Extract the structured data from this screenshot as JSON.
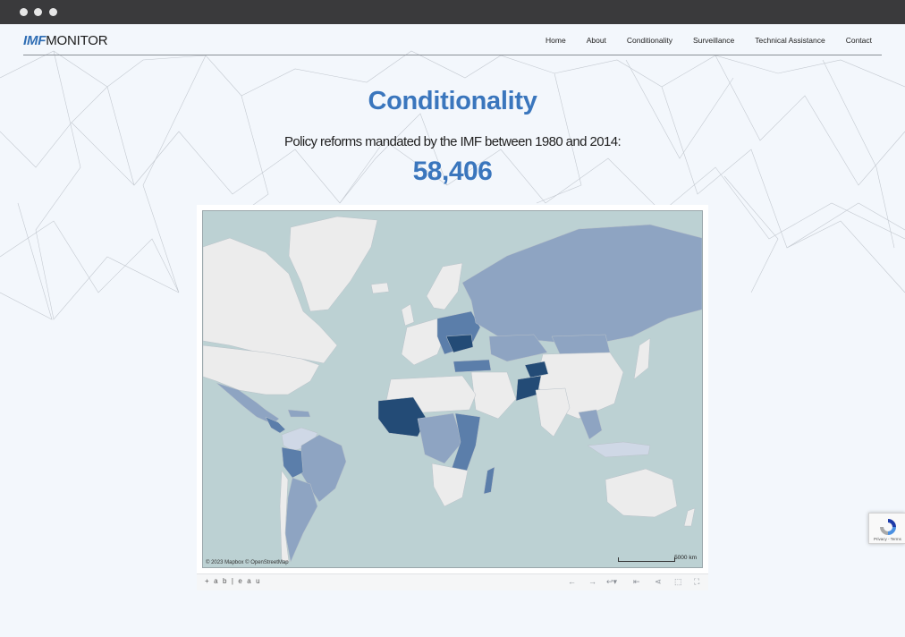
{
  "window": {
    "controls": [
      "close",
      "minimize",
      "zoom"
    ]
  },
  "header": {
    "logo_imf": "IMF",
    "logo_monitor": "MONITOR",
    "nav": [
      "Home",
      "About",
      "Conditionality",
      "Surveillance",
      "Technical Assistance",
      "Contact"
    ]
  },
  "main": {
    "title": "Conditionality",
    "subtitle": "Policy reforms mandated by the IMF between 1980 and 2014:",
    "total": "58,406"
  },
  "map": {
    "attribution": "© 2023 Mapbox  © OpenStreetMap",
    "scale": "5000 km",
    "colors": {
      "ocean": "#bcd1d3",
      "no_data": "#ececec",
      "low": "#cfd8e6",
      "medium": "#8ea4c2",
      "high": "#5b7eaa",
      "very_high": "#234b76"
    }
  },
  "toolbar": {
    "logo": "+ a b | e a u",
    "icons": [
      "undo-icon",
      "redo-icon",
      "revert-icon",
      "reset-icon",
      "share-icon",
      "download-icon",
      "fullscreen-icon"
    ]
  },
  "recaptcha": {
    "links": "Privacy - Terms"
  }
}
